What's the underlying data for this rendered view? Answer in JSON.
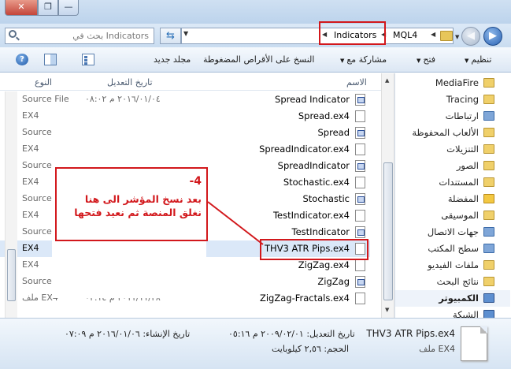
{
  "window": {
    "buttons": {
      "close": "✕",
      "maximize": "❐",
      "minimize": "—"
    }
  },
  "address": {
    "search_placeholder": "بحث في Indicators",
    "refresh_glyph": "⇆",
    "breadcrumb": [
      "MQL4",
      "Indicators"
    ],
    "back": "◀",
    "forward": "▶"
  },
  "toolbar": {
    "organize": "تنظيم",
    "open": "فتح",
    "share": "مشاركة مع",
    "burn": "النسخ على الأقراص المضغوطة",
    "new_folder": "مجلد جديد",
    "help": "?"
  },
  "columns": {
    "name": "الاسم",
    "date": "تاريخ التعديل",
    "type": "النوع"
  },
  "files": [
    {
      "name": "Spread Indicator",
      "date": "٢٠١٦/٠١/٠٤ م ٠٨:٠٢",
      "type": "Source File",
      "icon": "source-file-icon"
    },
    {
      "name": "Spread.ex4",
      "date": "",
      "type": "EX4",
      "icon": "ex4-file-icon"
    },
    {
      "name": "Spread",
      "date": "",
      "type": "Source I",
      "icon": "source-file-icon"
    },
    {
      "name": "SpreadIndicator.ex4",
      "date": "",
      "type": "EX4",
      "icon": "ex4-file-icon"
    },
    {
      "name": "SpreadIndicator",
      "date": "",
      "type": "Source I",
      "icon": "source-file-icon"
    },
    {
      "name": "Stochastic.ex4",
      "date": "",
      "type": "EX4",
      "icon": "ex4-file-icon"
    },
    {
      "name": "Stochastic",
      "date": "",
      "type": "Source I",
      "icon": "source-file-icon"
    },
    {
      "name": "TestIndicator.ex4",
      "date": "",
      "type": "EX4",
      "icon": "ex4-file-icon"
    },
    {
      "name": "TestIndicator",
      "date": "",
      "type": "Source I",
      "icon": "source-file-icon"
    },
    {
      "name": "THV3 ATR Pips.ex4",
      "date": "",
      "type": "EX4",
      "icon": "ex4-file-icon"
    },
    {
      "name": "ZigZag.ex4",
      "date": "",
      "type": "EX4",
      "icon": "ex4-file-icon"
    },
    {
      "name": "ZigZag",
      "date": "",
      "type": "Source I",
      "icon": "source-file-icon"
    },
    {
      "name": "ZigZag-Fractals.ex4",
      "date": "٢٠١١/١١/٢٨ م ٠٢:١٤",
      "type": "ملف EX4",
      "icon": "ex4-file-icon"
    }
  ],
  "selected_index": 9,
  "nav": [
    {
      "label": "MediaFire",
      "icon": "folder-icon"
    },
    {
      "label": "Tracing",
      "icon": "folder-icon"
    },
    {
      "label": "ارتباطات",
      "icon": "links-folder-icon"
    },
    {
      "label": "الألعاب المحفوظة",
      "icon": "saved-games-icon"
    },
    {
      "label": "التنزيلات",
      "icon": "downloads-folder-icon"
    },
    {
      "label": "الصور",
      "icon": "pictures-folder-icon"
    },
    {
      "label": "المستندات",
      "icon": "documents-folder-icon"
    },
    {
      "label": "المفضلة",
      "icon": "favorites-star-icon"
    },
    {
      "label": "الموسيقى",
      "icon": "music-folder-icon"
    },
    {
      "label": "جهات الاتصال",
      "icon": "contacts-folder-icon"
    },
    {
      "label": "سطح المكتب",
      "icon": "desktop-folder-icon"
    },
    {
      "label": "ملفات الفيديو",
      "icon": "videos-folder-icon"
    },
    {
      "label": "نتائج البحث",
      "icon": "searches-folder-icon"
    },
    {
      "label": "الكمبيوتر",
      "icon": "computer-icon"
    },
    {
      "label": "الشبكة",
      "icon": "network-icon"
    }
  ],
  "details": {
    "filename": "THV3 ATR Pips.ex4",
    "filetype": "ملف EX4",
    "modified": "تاريخ التعديل: ٢٠٠٩/٠٢/٠١ م ٠٥:١٦",
    "size": "الحجم: ٢,٥٦ كيلوبايت",
    "created": "تاريخ الإنشاء: ٢٠١٦/٠١/٠٦ م ٠٧:٠٩"
  },
  "annotation": {
    "number": "-4",
    "text": "بعد نسخ المؤشر الى هنا نغلق المنصة ثم نعيد فتحها"
  }
}
